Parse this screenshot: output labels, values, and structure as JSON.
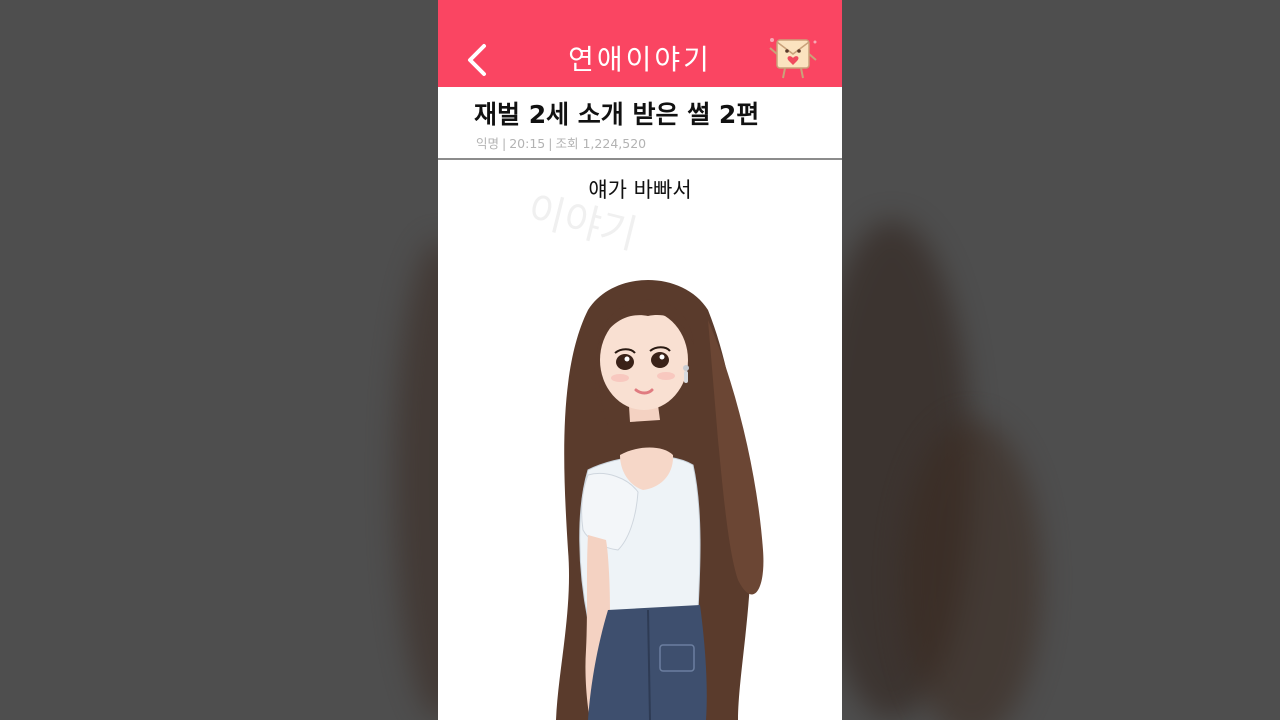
{
  "header": {
    "back_icon": "chevron-left-icon",
    "title": "연애이야기",
    "mascot_icon": "letter-mascot-icon",
    "accent_color": "#fa4562"
  },
  "post": {
    "title": "재벌 2세 소개 받은 썰 2편",
    "author": "익명",
    "time": "20:15",
    "views_label": "조회",
    "views": "1,224,520"
  },
  "content": {
    "caption": "얘가 바빠서",
    "watermark": "이야기",
    "image_subject": "illustrated-girl-image"
  }
}
